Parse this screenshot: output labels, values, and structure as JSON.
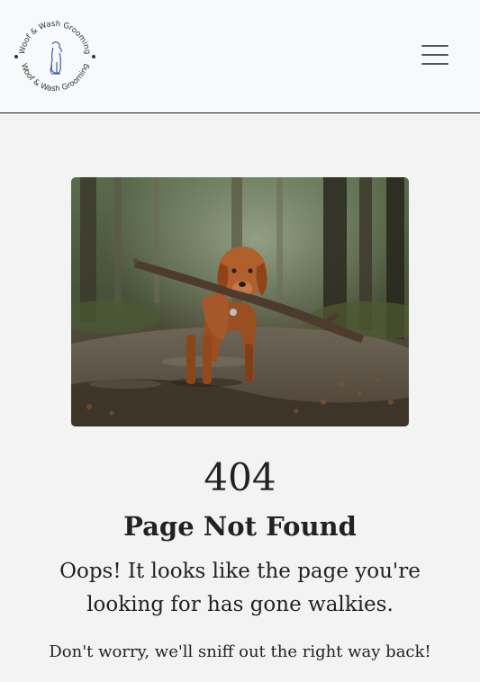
{
  "header": {
    "logo_text": "Woof & Wash Grooming",
    "logo_icon": "dog-sitting-icon",
    "menu_icon": "hamburger-menu-icon"
  },
  "hero": {
    "image_alt": "Dog carrying a stick in the woods",
    "image_description_icon": "dog-with-stick-photo"
  },
  "error": {
    "code": "404",
    "title": "Page Not Found",
    "message": "Oops! It looks like the page you're looking for has gone walkies.",
    "subtext": "Don't worry, we'll sniff out the right way back!"
  },
  "colors": {
    "page_background": "#f3f3f3",
    "navbar_background": "#f8f9fa",
    "text": "#222222",
    "logo_accent": "#2a4fa0"
  }
}
